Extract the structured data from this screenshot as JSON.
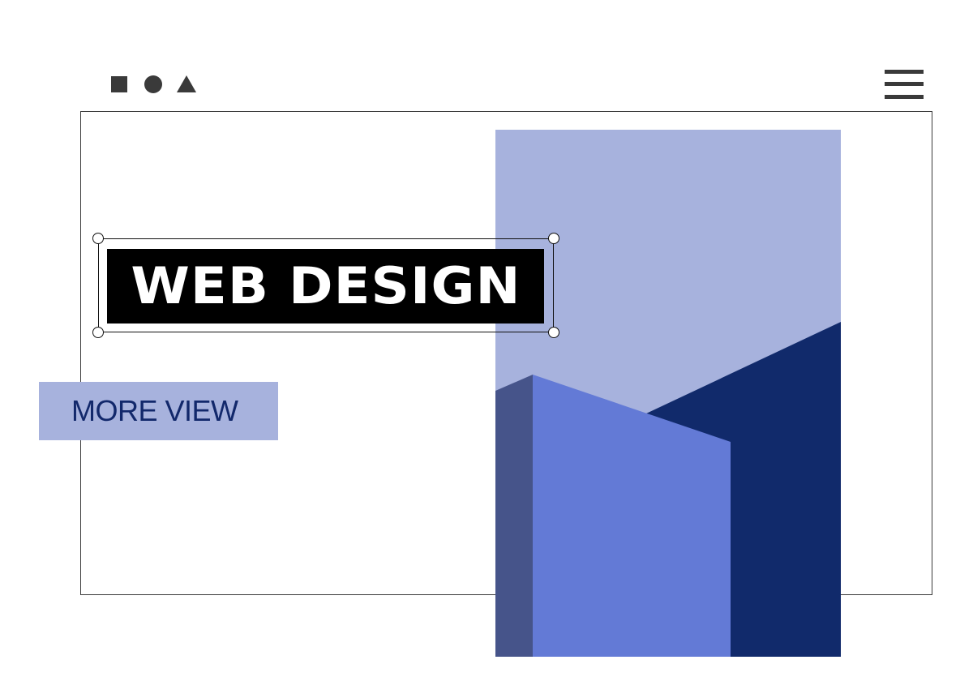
{
  "logo": {
    "icons": [
      "square-icon",
      "circle-icon",
      "triangle-icon"
    ],
    "color": "#3a3a3a"
  },
  "nav": {
    "menu_icon": "hamburger-menu-icon"
  },
  "hero": {
    "title": "WEB DESIGN",
    "cta_label": "MORE VIEW"
  },
  "colors": {
    "light_blue": "#a7b2dd",
    "mid_blue": "#637ad6",
    "dark_navy": "#112a6b",
    "slate_blue": "#46548a",
    "title_bg": "#000000",
    "title_text": "#ffffff",
    "cta_text": "#12286b"
  }
}
